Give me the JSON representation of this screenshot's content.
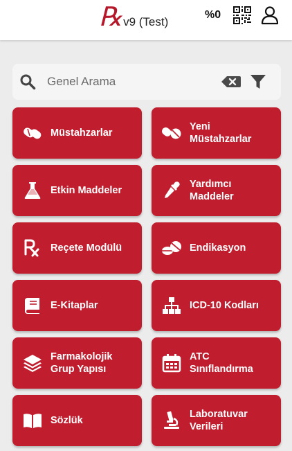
{
  "header": {
    "logo_symbol": "℞",
    "version": "v9 (Test)",
    "percent": "%0",
    "qr_icon": "qr-code-icon",
    "user_icon": "user-icon"
  },
  "search": {
    "placeholder": "Genel Arama",
    "value": "",
    "search_icon": "search-icon",
    "clear_icon": "backspace-icon",
    "filter_icon": "filter-icon"
  },
  "colors": {
    "accent": "#c01e2e",
    "logo": "#b5182a",
    "background": "#ececec"
  },
  "menu": [
    {
      "label": "Müstahzarlar",
      "icon": "pills-icon"
    },
    {
      "label": "Yeni\nMüstahzarlar",
      "icon": "pills-new-icon"
    },
    {
      "label": "Etkin Maddeler",
      "icon": "flask-icon"
    },
    {
      "label": "Yardımcı\nMaddeler",
      "icon": "eyedropper-icon"
    },
    {
      "label": "Reçete Modülü",
      "icon": "prescription-icon"
    },
    {
      "label": "Endikasyon",
      "icon": "capsules-icon"
    },
    {
      "label": "E-Kitaplar",
      "icon": "book-icon"
    },
    {
      "label": "ICD-10 Kodları",
      "icon": "sitemap-icon"
    },
    {
      "label": "Farmakolojik\nGrup Yapısı",
      "icon": "layers-icon"
    },
    {
      "label": "ATC\nSınıflandırma",
      "icon": "calendar-icon"
    },
    {
      "label": "Sözlük",
      "icon": "open-book-icon"
    },
    {
      "label": "Laboratuvar\nVerileri",
      "icon": "microscope-icon"
    }
  ]
}
